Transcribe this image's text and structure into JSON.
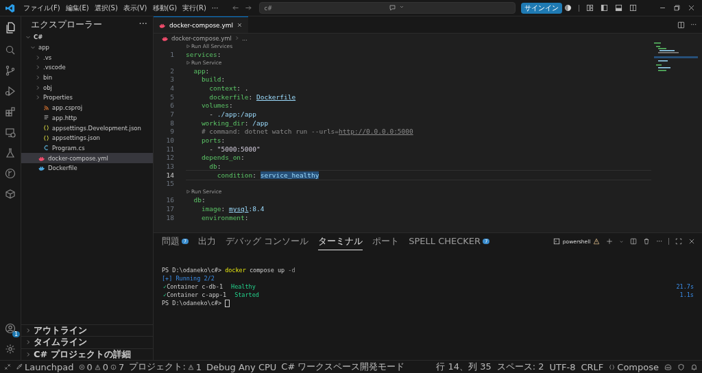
{
  "title_bar": {
    "menus": [
      "ファイル(F)",
      "編集(E)",
      "選択(S)",
      "表示(V)",
      "移動(G)",
      "実行(R)",
      "···"
    ],
    "search": {
      "value": "c#"
    },
    "sign_in": "サインイン"
  },
  "sidebar": {
    "title": "エクスプローラー",
    "more": "···",
    "tree": [
      {
        "label": "C#",
        "kind": "folder",
        "expanded": true,
        "selected": false,
        "children": [
          {
            "label": "app",
            "kind": "folder",
            "expanded": true,
            "selected": false,
            "children": [
              {
                "label": ".vs",
                "kind": "folder",
                "expanded": false,
                "selected": false
              },
              {
                "label": ".vscode",
                "kind": "folder",
                "expanded": false,
                "selected": false
              },
              {
                "label": "bin",
                "kind": "folder",
                "expanded": false,
                "selected": false
              },
              {
                "label": "obj",
                "kind": "folder",
                "expanded": false,
                "selected": false
              },
              {
                "label": "Properties",
                "kind": "folder",
                "expanded": false,
                "selected": false
              },
              {
                "label": "app.csproj",
                "kind": "csproj",
                "selected": false
              },
              {
                "label": "app.http",
                "kind": "http",
                "selected": false
              },
              {
                "label": "appsettings.Development.json",
                "kind": "json",
                "selected": false
              },
              {
                "label": "appsettings.json",
                "kind": "json",
                "selected": false
              },
              {
                "label": "Program.cs",
                "kind": "cs",
                "selected": false
              }
            ]
          },
          {
            "label": "docker-compose.yml",
            "kind": "compose",
            "selected": true
          },
          {
            "label": "Dockerfile",
            "kind": "docker",
            "selected": false
          }
        ]
      }
    ],
    "sections": [
      "アウトライン",
      "タイムライン",
      "C# プロジェクトの詳細"
    ]
  },
  "account_badge": "1",
  "editor": {
    "tab": "docker-compose.yml",
    "more": "···",
    "breadcrumb": [
      "docker-compose.yml",
      "..."
    ],
    "lines": [
      {
        "kind": "codelens",
        "text": "Run All Services"
      },
      {
        "kind": "code",
        "number": "1",
        "current": false,
        "tokens": [
          {
            "text": "services",
            "kind": "key"
          },
          {
            "text": ":",
            "kind": "punct"
          }
        ]
      },
      {
        "kind": "codelens",
        "text": "Run Service"
      },
      {
        "kind": "code",
        "number": "2",
        "current": false,
        "tokens": [
          {
            "text": "  app",
            "kind": "key"
          },
          {
            "text": ":",
            "kind": "punct"
          }
        ]
      },
      {
        "kind": "code",
        "number": "3",
        "current": false,
        "tokens": [
          {
            "text": "    build",
            "kind": "key"
          },
          {
            "text": ":",
            "kind": "punct"
          }
        ]
      },
      {
        "kind": "code",
        "number": "4",
        "current": false,
        "tokens": [
          {
            "text": "      context",
            "kind": "key"
          },
          {
            "text": ": .",
            "kind": "punct"
          }
        ]
      },
      {
        "kind": "code",
        "number": "5",
        "current": false,
        "tokens": [
          {
            "text": "      dockerfile",
            "kind": "key"
          },
          {
            "text": ": ",
            "kind": "punct"
          },
          {
            "text": "Dockerfile",
            "kind": "link"
          }
        ]
      },
      {
        "kind": "code",
        "number": "6",
        "current": false,
        "tokens": [
          {
            "text": "    volumes",
            "kind": "key"
          },
          {
            "text": ":",
            "kind": "punct"
          }
        ]
      },
      {
        "kind": "code",
        "number": "7",
        "current": false,
        "tokens": [
          {
            "text": "      - ",
            "kind": "punct"
          },
          {
            "text": "./app:/app",
            "kind": "value"
          }
        ]
      },
      {
        "kind": "code",
        "number": "8",
        "current": false,
        "tokens": [
          {
            "text": "    working_dir",
            "kind": "key"
          },
          {
            "text": ": ",
            "kind": "punct"
          },
          {
            "text": "/app",
            "kind": "value"
          }
        ]
      },
      {
        "kind": "code",
        "number": "9",
        "current": false,
        "tokens": [
          {
            "text": "    # command: dotnet watch run --urls=",
            "kind": "comment"
          },
          {
            "text": "http://0.0.0.0:5000",
            "kind": "commentlink"
          }
        ]
      },
      {
        "kind": "code",
        "number": "10",
        "current": false,
        "tokens": [
          {
            "text": "    ports",
            "kind": "key"
          },
          {
            "text": ":",
            "kind": "punct"
          }
        ]
      },
      {
        "kind": "code",
        "number": "11",
        "current": false,
        "tokens": [
          {
            "text": "      - ",
            "kind": "punct"
          },
          {
            "text": "\"5000:5000\"",
            "kind": "string"
          }
        ]
      },
      {
        "kind": "code",
        "number": "12",
        "current": false,
        "tokens": [
          {
            "text": "    depends_on",
            "kind": "key"
          },
          {
            "text": ":",
            "kind": "punct"
          }
        ]
      },
      {
        "kind": "code",
        "number": "13",
        "current": false,
        "tokens": [
          {
            "text": "      db",
            "kind": "key"
          },
          {
            "text": ":",
            "kind": "punct"
          }
        ]
      },
      {
        "kind": "code",
        "number": "14",
        "current": true,
        "tokens": [
          {
            "text": "        condition",
            "kind": "key"
          },
          {
            "text": ": ",
            "kind": "punct"
          },
          {
            "text": "service_healthy",
            "kind": "match"
          }
        ]
      },
      {
        "kind": "code",
        "number": "15",
        "current": false
      },
      {
        "kind": "codelens",
        "text": "Run Service"
      },
      {
        "kind": "code",
        "number": "16",
        "current": false,
        "tokens": [
          {
            "text": "  db",
            "kind": "key"
          },
          {
            "text": ":",
            "kind": "punct"
          }
        ]
      },
      {
        "kind": "code",
        "number": "17",
        "current": false,
        "tokens": [
          {
            "text": "    image",
            "kind": "key"
          },
          {
            "text": ": ",
            "kind": "punct"
          },
          {
            "text": "mysql",
            "kind": "link"
          },
          {
            "text": ":8.4",
            "kind": "value"
          }
        ]
      },
      {
        "kind": "code",
        "number": "18",
        "current": false,
        "tokens": [
          {
            "text": "    environment",
            "kind": "key"
          },
          {
            "text": ":",
            "kind": "punct"
          }
        ]
      }
    ]
  },
  "panel": {
    "tabs": [
      {
        "label": "問題",
        "badge": "7",
        "selected": false
      },
      {
        "label": "出力",
        "selected": false
      },
      {
        "label": "デバッグ コンソール",
        "selected": false
      },
      {
        "label": "ターミナル",
        "selected": true
      },
      {
        "label": "ポート",
        "selected": false
      },
      {
        "label": "SPELL CHECKER",
        "badge": "7",
        "selected": false
      }
    ],
    "shell": "powershell",
    "more": "···",
    "terminal": [
      {
        "tokens": [
          {
            "text": "PS D:\\odaneko\\c#> ",
            "kind": "plain"
          },
          {
            "text": "docker",
            "kind": "cmd"
          },
          {
            "text": " compose up ",
            "kind": "plain"
          },
          {
            "text": "-d",
            "kind": "dim"
          }
        ]
      },
      {
        "tokens": [
          {
            "text": "[+] Running 2/2",
            "kind": "info"
          }
        ]
      },
      {
        "check": "✓",
        "tokens": [
          {
            "text": "Container c-db-1",
            "kind": "plain"
          },
          {
            "text": "Healthy",
            "kind": "ok"
          }
        ],
        "time": "21.7s"
      },
      {
        "check": "✓",
        "tokens": [
          {
            "text": "Container c-app-1",
            "kind": "plain"
          },
          {
            "text": "Started",
            "kind": "ok"
          }
        ],
        "time": "1.1s"
      },
      {
        "cursor": true,
        "tokens": [
          {
            "text": "PS D:\\odaneko\\c#> ",
            "kind": "plain"
          }
        ]
      }
    ]
  },
  "status_bar": {
    "left": [
      {
        "kind": "remote"
      },
      {
        "kind": "launchpad",
        "text": "Launchpad"
      },
      {
        "kind": "problems",
        "errors": "0",
        "warnings": "0",
        "infos": "7"
      },
      {
        "kind": "project",
        "text": "プロジェクト:",
        "count": "1"
      },
      {
        "kind": "text",
        "text": "Debug Any CPU"
      },
      {
        "kind": "text",
        "text": "C# ワークスペース開発モード"
      }
    ],
    "right": [
      {
        "kind": "text",
        "text": "行 14、列 35"
      },
      {
        "kind": "text",
        "text": "スペース: 2"
      },
      {
        "kind": "text",
        "text": "UTF-8"
      },
      {
        "kind": "text",
        "text": "CRLF"
      },
      {
        "kind": "language",
        "text": "Compose"
      },
      {
        "kind": "copilot"
      },
      {
        "kind": "extension"
      },
      {
        "kind": "bell"
      }
    ]
  }
}
